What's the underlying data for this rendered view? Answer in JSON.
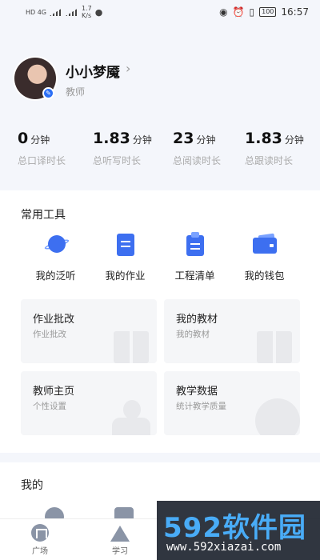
{
  "status_bar": {
    "network_left": "HD 4G",
    "speed": "1.7",
    "speed_unit": "K/s",
    "battery": "100",
    "time": "16:57"
  },
  "profile": {
    "name": "小小梦魇",
    "role": "教师"
  },
  "stats": [
    {
      "value": "0",
      "unit": "分钟",
      "label": "总口译时长"
    },
    {
      "value": "1.83",
      "unit": "分钟",
      "label": "总听写时长"
    },
    {
      "value": "23",
      "unit": "分钟",
      "label": "总阅读时长"
    },
    {
      "value": "1.83",
      "unit": "分钟",
      "label": "总跟读时长"
    }
  ],
  "tools": {
    "title": "常用工具",
    "items": [
      {
        "label": "我的泛听",
        "icon": "planet-icon"
      },
      {
        "label": "我的作业",
        "icon": "document-icon"
      },
      {
        "label": "工程清单",
        "icon": "clipboard-icon"
      },
      {
        "label": "我的钱包",
        "icon": "wallet-icon"
      }
    ],
    "cards": [
      {
        "title": "作业批改",
        "subtitle": "作业批改"
      },
      {
        "title": "我的教材",
        "subtitle": "我的教材"
      },
      {
        "title": "教师主页",
        "subtitle": "个性设置"
      },
      {
        "title": "教学数据",
        "subtitle": "统计教学质量"
      }
    ]
  },
  "my_section": {
    "title": "我的"
  },
  "bottom_nav": [
    {
      "label": "广场",
      "icon": "square-icon"
    },
    {
      "label": "学习",
      "icon": "mountain-icon"
    }
  ],
  "watermark": {
    "logo": "592软件园",
    "url": "www.592xiazai.com"
  },
  "colors": {
    "accent": "#3d6ff0",
    "background": "#f4f6fb"
  }
}
